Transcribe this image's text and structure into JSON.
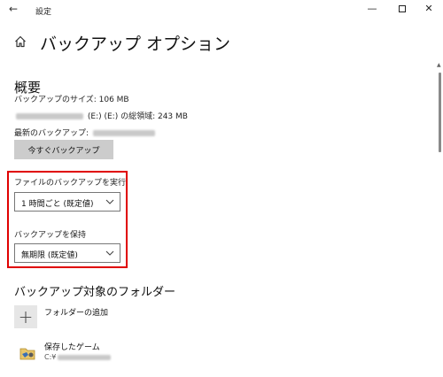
{
  "window": {
    "title": "設定",
    "back_icon": "back-arrow-icon",
    "minimize_glyph": "—",
    "close_glyph": "✕"
  },
  "page": {
    "title": "バックアップ オプション",
    "icon": "home-icon"
  },
  "overview": {
    "heading": "概要",
    "backup_size": "バックアップのサイズ: 106 MB",
    "drive_label": "(E:) (E:) の総領域: 243 MB",
    "last_backup_label": "最新のバックアップ:",
    "backup_now_button": "今すぐバックアップ"
  },
  "settings": {
    "frequency_label": "ファイルのバックアップを実行",
    "frequency_value": "1 時間ごと (既定値)",
    "retention_label": "バックアップを保持",
    "retention_value": "無期限 (既定値)",
    "highlight_color": "#e00000"
  },
  "folders": {
    "heading": "バックアップ対象のフォルダー",
    "add_label": "フォルダーの追加",
    "add_glyph": "+",
    "items": [
      {
        "name": "保存したゲーム",
        "path": "C:¥"
      }
    ]
  }
}
